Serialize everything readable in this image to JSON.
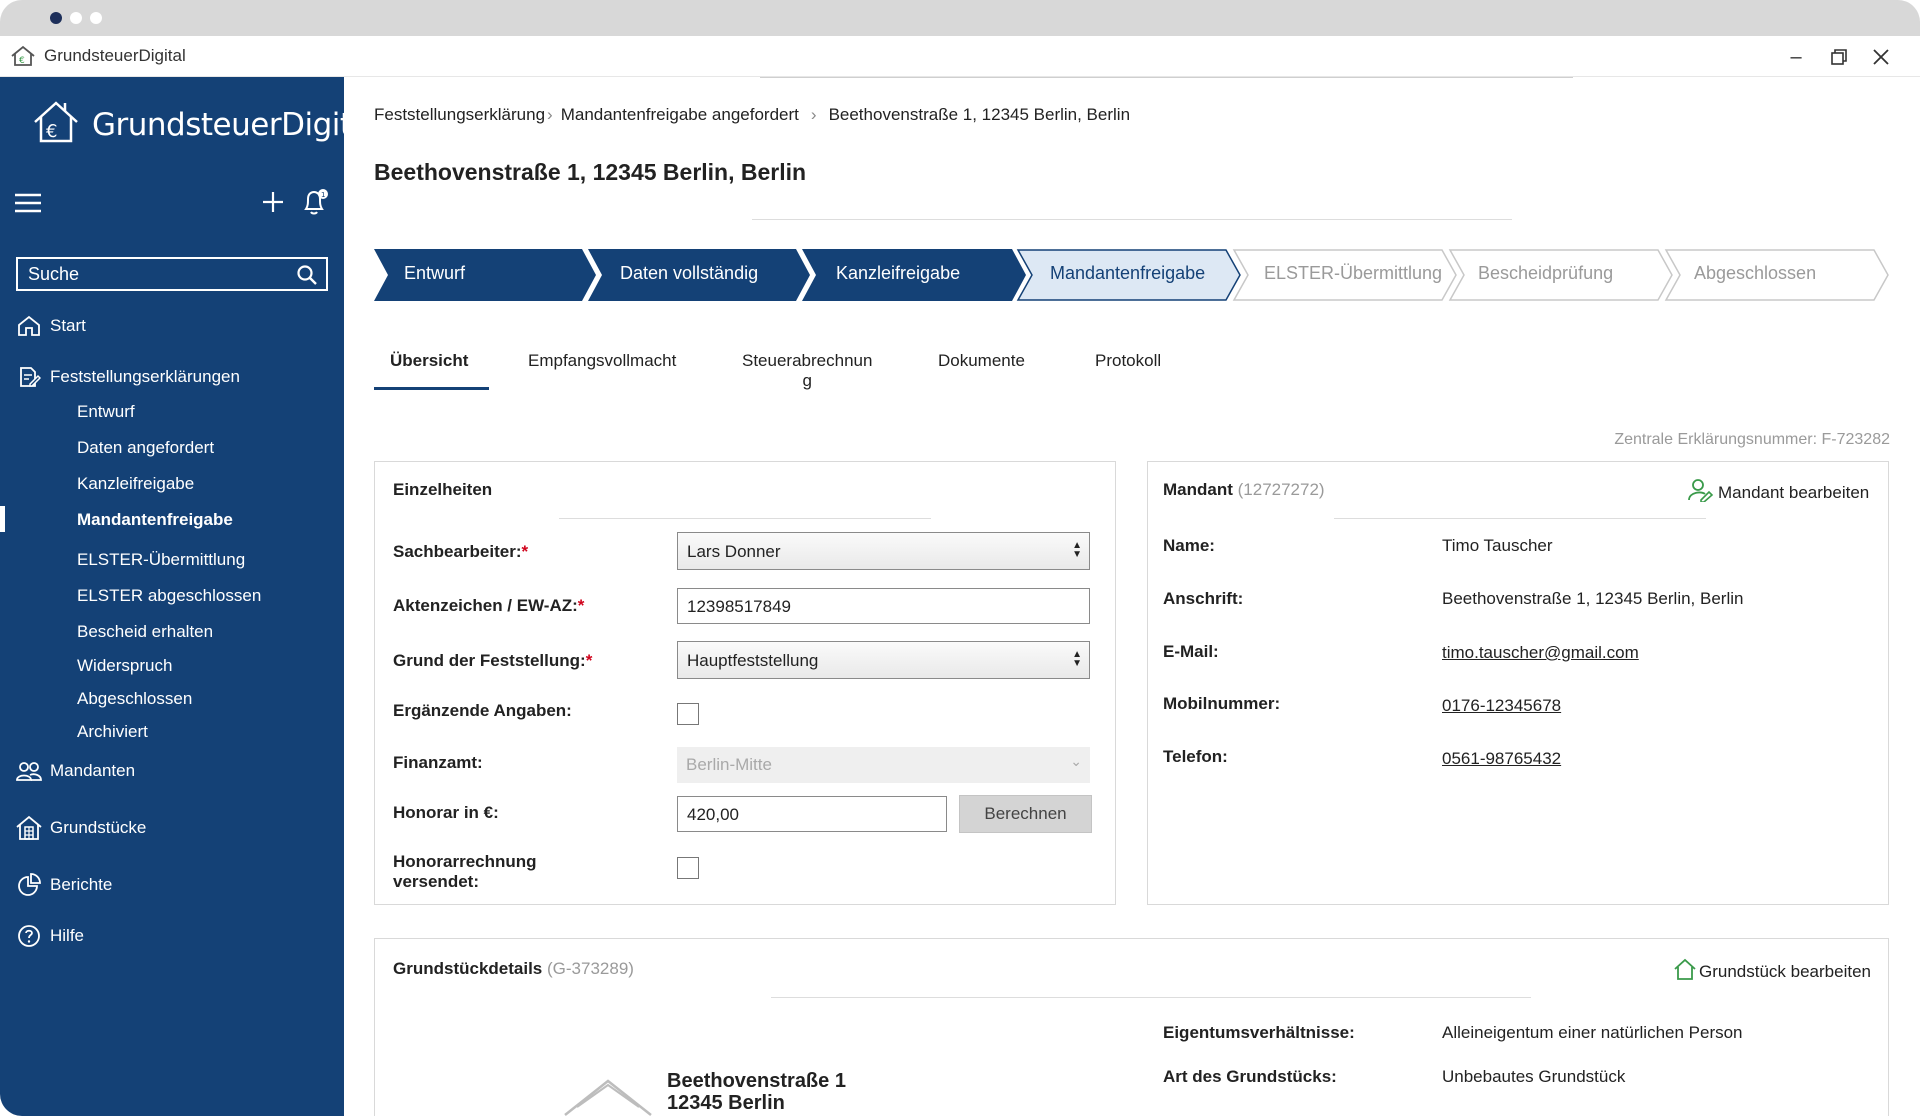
{
  "app": {
    "window_title": "GrundsteuerDigital",
    "logo_text": "GrundsteuerDigital"
  },
  "sidebar": {
    "search_placeholder": "Suche",
    "items": [
      {
        "label": "Start",
        "icon": "home-icon"
      },
      {
        "label": "Feststellungserklärungen",
        "icon": "document-edit-icon"
      },
      {
        "label": "Mandanten",
        "icon": "users-icon"
      },
      {
        "label": "Grundstücke",
        "icon": "building-icon"
      },
      {
        "label": "Berichte",
        "icon": "pie-chart-icon"
      },
      {
        "label": "Hilfe",
        "icon": "help-icon"
      }
    ],
    "sub_items": [
      {
        "label": "Entwurf"
      },
      {
        "label": "Daten angefordert"
      },
      {
        "label": "Kanzleifreigabe"
      },
      {
        "label": "Mandantenfreigabe",
        "active": true
      },
      {
        "label": "ELSTER-Übermittlung"
      },
      {
        "label": "ELSTER abgeschlossen"
      },
      {
        "label": "Bescheid erhalten"
      },
      {
        "label": "Widerspruch"
      },
      {
        "label": "Abgeschlossen"
      },
      {
        "label": "Archiviert"
      }
    ]
  },
  "breadcrumb": [
    "Feststellungserklärung",
    "Mandantenfreigabe angefordert",
    "Beethovenstraße 1, 12345 Berlin, Berlin"
  ],
  "page_title": "Beethovenstraße 1, 12345 Berlin, Berlin",
  "steps": [
    {
      "label": "Entwurf",
      "state": "done"
    },
    {
      "label": "Daten vollständig",
      "state": "done"
    },
    {
      "label": "Kanzleifreigabe",
      "state": "done"
    },
    {
      "label": "Mandantenfreigabe",
      "state": "current"
    },
    {
      "label": "ELSTER-Übermittlung",
      "state": "todo"
    },
    {
      "label": "Bescheidprüfung",
      "state": "todo"
    },
    {
      "label": "Abgeschlossen",
      "state": "todo"
    }
  ],
  "colors": {
    "primary": "#144176",
    "current_step": "#dde8f4",
    "required": "#d0021b",
    "green_icon": "#3a9a4a"
  },
  "tabs": [
    {
      "label": "Übersicht",
      "active": true
    },
    {
      "label": "Empfangsvollmacht"
    },
    {
      "label": "Steuerabrechnun",
      "label2": "g"
    },
    {
      "label": "Dokumente"
    },
    {
      "label": "Protokoll"
    }
  ],
  "ref_number": "Zentrale Erklärungsnummer: F-723282",
  "einzelheiten": {
    "title": "Einzelheiten",
    "sachbearbeiter_label": "Sachbearbeiter:",
    "sachbearbeiter_value": "Lars Donner",
    "aktenzeichen_label": "Aktenzeichen / EW-AZ:",
    "aktenzeichen_value": "12398517849",
    "grund_label": "Grund der Feststellung:",
    "grund_value": "Hauptfeststellung",
    "ergaenzende_label": "Ergänzende Angaben:",
    "finanzamt_label": "Finanzamt:",
    "finanzamt_value": "Berlin-Mitte",
    "honorar_label": "Honorar in €:",
    "honorar_value": "420,00",
    "berechnen_label": "Berechnen",
    "honorarrechnung_label_1": "Honorarrechnung",
    "honorarrechnung_label_2": "versendet:",
    "required_mark": "*"
  },
  "mandant": {
    "title": "Mandant",
    "id": "(12727272)",
    "edit_label": "Mandant bearbeiten",
    "name_label": "Name:",
    "name_value": "Timo Tauscher",
    "anschrift_label": "Anschrift:",
    "anschrift_value": "Beethovenstraße 1, 12345 Berlin, Berlin",
    "email_label": "E-Mail:",
    "email_value": "timo.tauscher@gmail.com",
    "mobil_label": "Mobilnummer:",
    "mobil_value": "0176-12345678",
    "telefon_label": "Telefon:",
    "telefon_value": "0561-98765432"
  },
  "grundstueck": {
    "title": "Grundstückdetails",
    "id": "(G-373289)",
    "edit_label": "Grundstück bearbeiten",
    "address_line1": "Beethovenstraße 1",
    "address_line2": "12345 Berlin",
    "eigentum_label": "Eigentumsverhältnisse:",
    "eigentum_value": "Alleineigentum einer natürlichen Person",
    "art_label": "Art des Grundstücks:",
    "art_value": "Unbebautes Grundstück"
  }
}
